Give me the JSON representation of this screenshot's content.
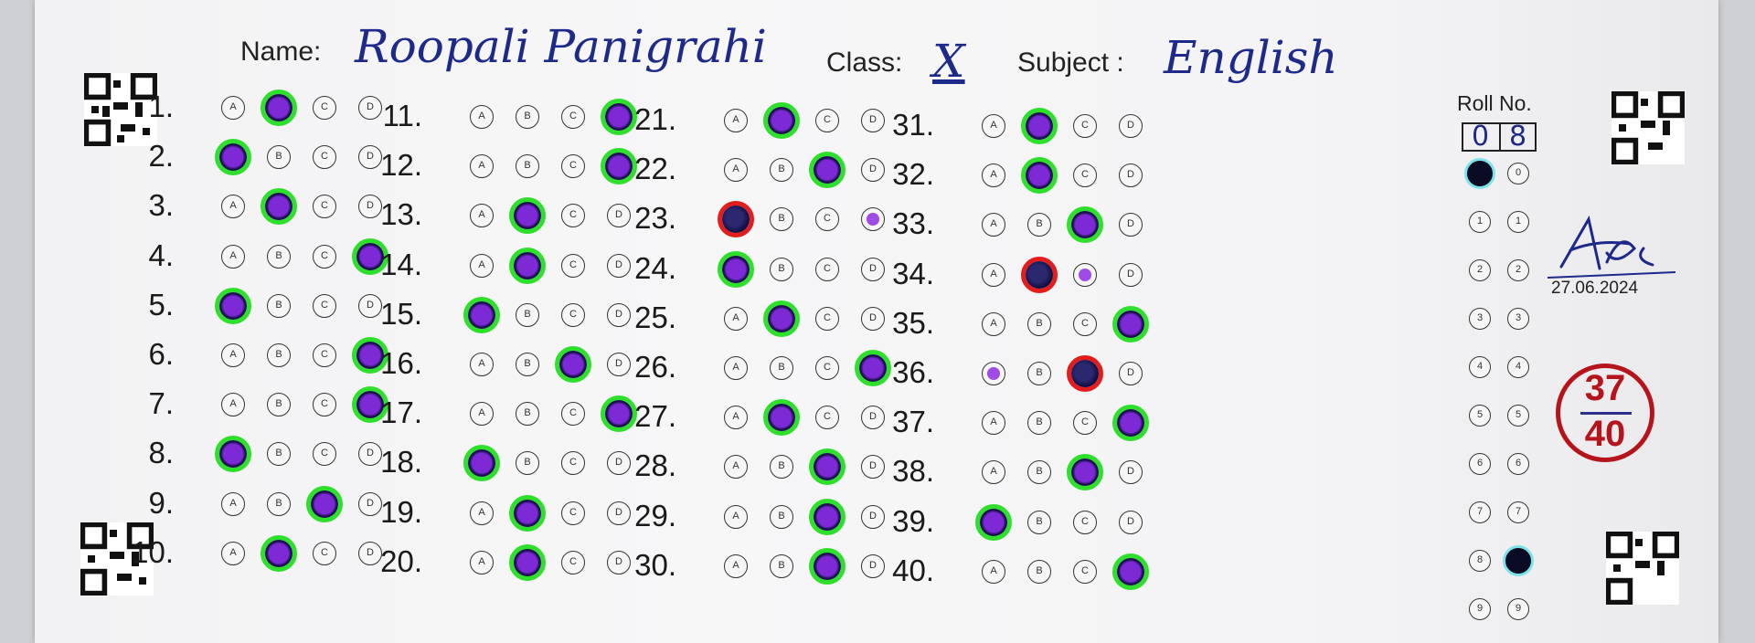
{
  "header": {
    "name_label": "Name:",
    "name_value": "Roopali Panigrahi",
    "class_label": "Class:",
    "class_value": "X",
    "subject_label": "Subject :",
    "subject_value": "English"
  },
  "options": [
    "A",
    "B",
    "C",
    "D"
  ],
  "questions": [
    {
      "n": "1.",
      "ans": 1,
      "mark": "g"
    },
    {
      "n": "2.",
      "ans": 0,
      "mark": "g"
    },
    {
      "n": "3.",
      "ans": 1,
      "mark": "g"
    },
    {
      "n": "4.",
      "ans": 3,
      "mark": "g"
    },
    {
      "n": "5.",
      "ans": 0,
      "mark": "g"
    },
    {
      "n": "6.",
      "ans": 3,
      "mark": "g"
    },
    {
      "n": "7.",
      "ans": 3,
      "mark": "g"
    },
    {
      "n": "8.",
      "ans": 0,
      "mark": "g"
    },
    {
      "n": "9.",
      "ans": 2,
      "mark": "g"
    },
    {
      "n": "10.",
      "ans": 1,
      "mark": "g"
    },
    {
      "n": "11.",
      "ans": 3,
      "mark": "g"
    },
    {
      "n": "12.",
      "ans": 3,
      "mark": "g"
    },
    {
      "n": "13.",
      "ans": 1,
      "mark": "g"
    },
    {
      "n": "14.",
      "ans": 1,
      "mark": "g"
    },
    {
      "n": "15.",
      "ans": 0,
      "mark": "g"
    },
    {
      "n": "16.",
      "ans": 2,
      "mark": "g"
    },
    {
      "n": "17.",
      "ans": 3,
      "mark": "g"
    },
    {
      "n": "18.",
      "ans": 0,
      "mark": "g"
    },
    {
      "n": "19.",
      "ans": 1,
      "mark": "g"
    },
    {
      "n": "20.",
      "ans": 1,
      "mark": "g"
    },
    {
      "n": "21.",
      "ans": 1,
      "mark": "g"
    },
    {
      "n": "22.",
      "ans": 2,
      "mark": "g"
    },
    {
      "n": "23.",
      "ans": 0,
      "mark": "r",
      "correct": 3
    },
    {
      "n": "24.",
      "ans": 0,
      "mark": "g"
    },
    {
      "n": "25.",
      "ans": 1,
      "mark": "g"
    },
    {
      "n": "26.",
      "ans": 3,
      "mark": "g"
    },
    {
      "n": "27.",
      "ans": 1,
      "mark": "g"
    },
    {
      "n": "28.",
      "ans": 2,
      "mark": "g"
    },
    {
      "n": "29.",
      "ans": 2,
      "mark": "g"
    },
    {
      "n": "30.",
      "ans": 2,
      "mark": "g"
    },
    {
      "n": "31.",
      "ans": 1,
      "mark": "g"
    },
    {
      "n": "32.",
      "ans": 1,
      "mark": "g"
    },
    {
      "n": "33.",
      "ans": 2,
      "mark": "g"
    },
    {
      "n": "34.",
      "ans": 1,
      "mark": "r",
      "correct": 2
    },
    {
      "n": "35.",
      "ans": 3,
      "mark": "g"
    },
    {
      "n": "36.",
      "ans": 2,
      "mark": "r",
      "correct": 0
    },
    {
      "n": "37.",
      "ans": 3,
      "mark": "g"
    },
    {
      "n": "38.",
      "ans": 2,
      "mark": "g"
    },
    {
      "n": "39.",
      "ans": 0,
      "mark": "g"
    },
    {
      "n": "40.",
      "ans": 3,
      "mark": "g"
    }
  ],
  "roll": {
    "label": "Roll No.",
    "digits": [
      "0",
      "8"
    ],
    "bubble_digits": [
      "0",
      "1",
      "2",
      "3",
      "4",
      "5",
      "6",
      "7",
      "8",
      "9"
    ]
  },
  "signature": {
    "date": "27.06.2024"
  },
  "score": {
    "obtained": "37",
    "total": "40"
  },
  "colors": {
    "correct_ring": "#2ee02c",
    "wrong_ring": "#e31c1c",
    "ink": "#1e2a8a",
    "score": "#b5141c"
  }
}
